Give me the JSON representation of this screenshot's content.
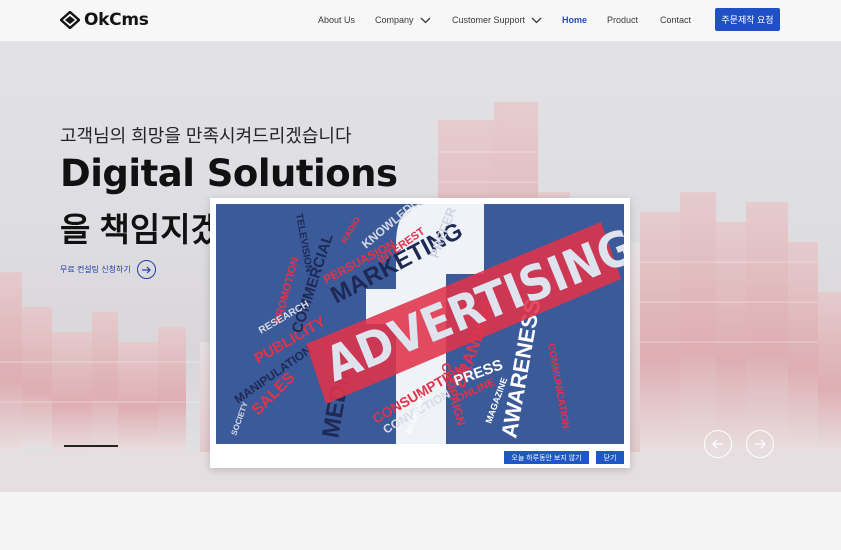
{
  "header": {
    "logo_text": "OkCms",
    "nav": [
      {
        "label": "About Us",
        "dropdown": false,
        "active": false
      },
      {
        "label": "Company",
        "dropdown": true,
        "active": false
      },
      {
        "label": "Customer Support",
        "dropdown": true,
        "active": false
      },
      {
        "label": "Home",
        "dropdown": false,
        "active": true
      },
      {
        "label": "Product",
        "dropdown": false,
        "active": false
      },
      {
        "label": "Contact",
        "dropdown": false,
        "active": false
      }
    ],
    "cta_label": "주문제작 요청"
  },
  "hero": {
    "subtitle": "고객님의 희망을 만족시켜드리겠습니다",
    "title": "Digital Solutions",
    "title_line2": "을 책임지겠",
    "consult_label": "무료 컨설팅 신청하기"
  },
  "popup": {
    "image_words": {
      "main": "ADVERTISING",
      "others": [
        "MARKETING",
        "MEDIA",
        "SALES",
        "PUBLICITY",
        "CONSUMPTION",
        "AWARENESS",
        "BRANDING",
        "PRESS",
        "ONLINE",
        "PERSUASION",
        "KNOWLEDGE",
        "INTEREST",
        "PREFER",
        "TELEVISION",
        "COMMERCIAL",
        "PROMOTION",
        "RESEARCH",
        "MANIPULATION",
        "CAMPAIGN",
        "CONVICTION",
        "MAGAZINE",
        "BILLBOARD",
        "COMMUNICATION",
        "RADIO",
        "SOCIETY"
      ]
    },
    "dont_show_today": "오늘 하루동안 보지 않기",
    "close": "닫기"
  },
  "colors": {
    "accent": "#2050c8",
    "active_nav": "#1f4ec7",
    "popup_red": "#e0334a",
    "popup_blue": "#3b5a9a"
  }
}
